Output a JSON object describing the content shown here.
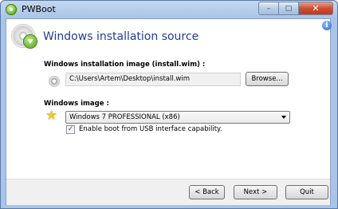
{
  "window": {
    "title": "PWBoot",
    "app_icon": "pwboot-icon"
  },
  "titlebar": {
    "minimize": "–",
    "maximize": "□",
    "close": "✕"
  },
  "header": {
    "title": "Windows installation source",
    "icon": "disc-download-icon",
    "info_glyph": "i"
  },
  "image_section": {
    "label": "Windows installation image (install.wim) :",
    "path_value": "C:\\Users\\Artem\\Desktop\\install.wim",
    "browse_label": "Browse..."
  },
  "windows_image": {
    "label": "Windows image :",
    "selected": "Windows 7 PROFESSIONAL (x86)",
    "usb_option_label": "Enable boot from USB interface capability.",
    "usb_option_checked": true,
    "check_glyph": "✓"
  },
  "footer": {
    "back_label": "< Back",
    "next_label": "Next >",
    "quit_label": "Quit"
  }
}
